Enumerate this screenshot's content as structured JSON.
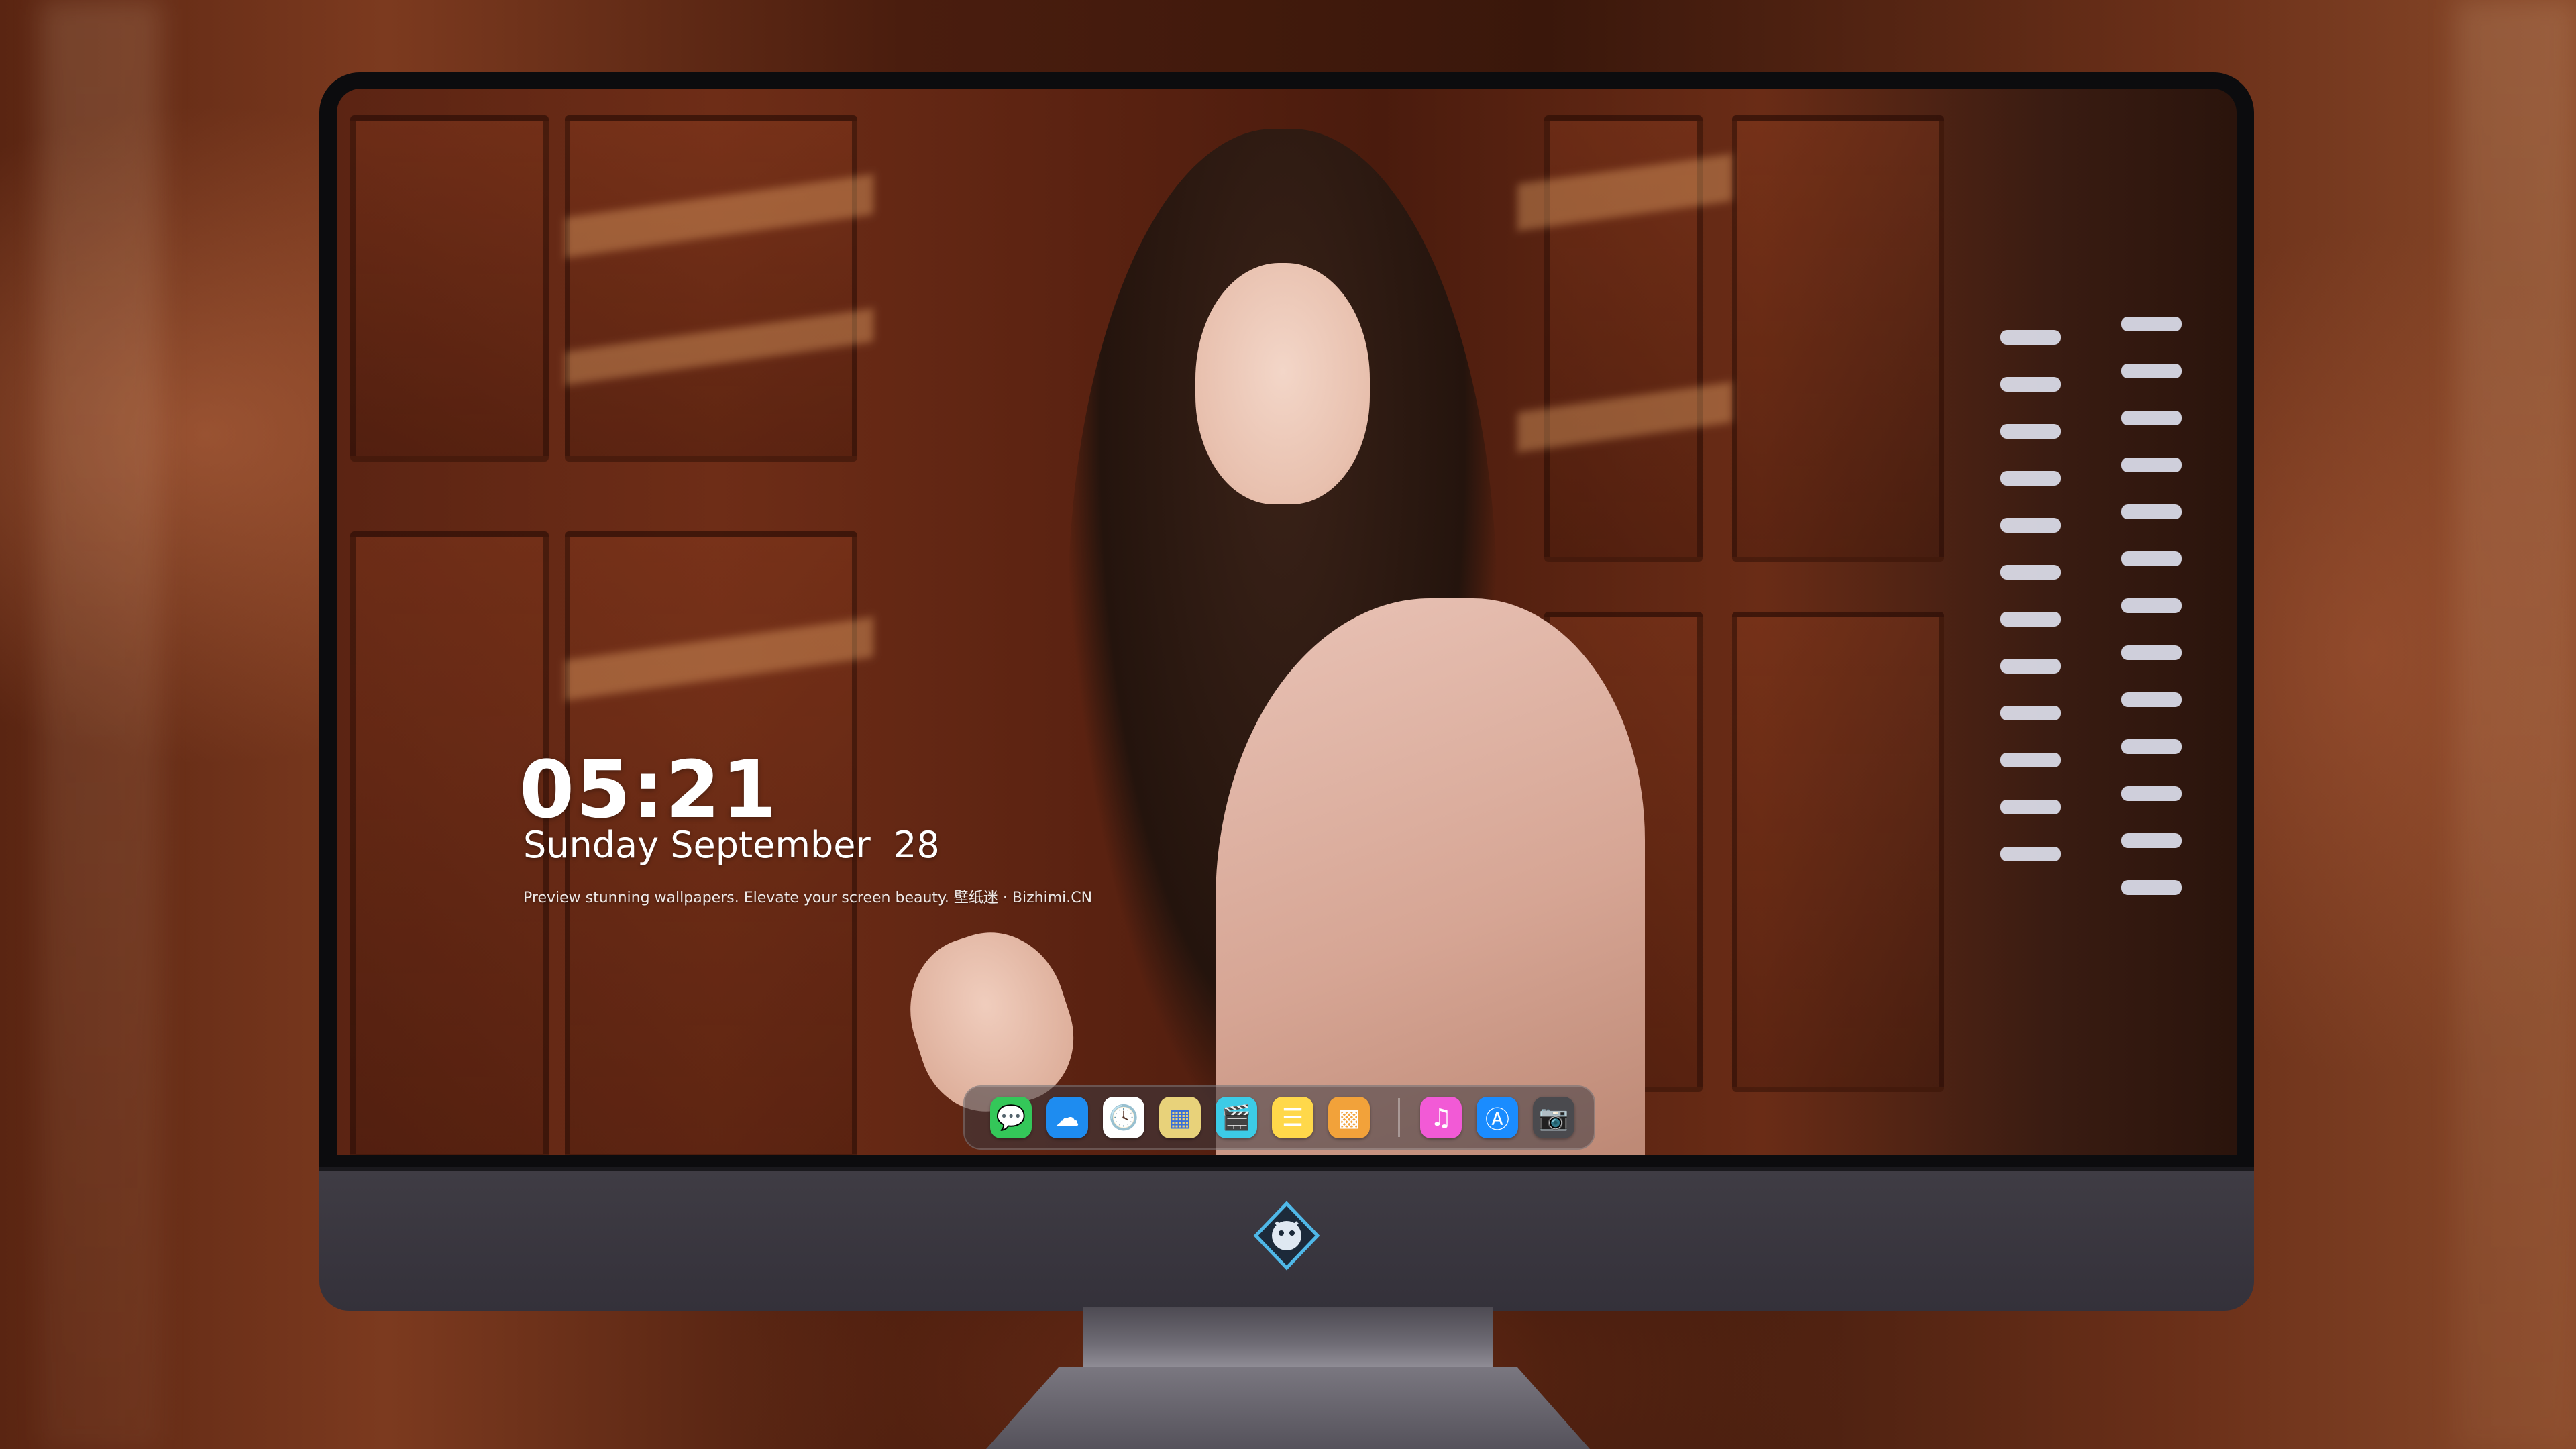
{
  "lock_screen": {
    "time": "05:21",
    "date": "Sunday September  28",
    "caption": "Preview stunning wallpapers. Elevate your screen beauty. 壁纸迷 · Bizhimi.CN"
  },
  "dock": {
    "apps": [
      {
        "name": "Messages",
        "icon": "messages-icon",
        "color": "#34c759",
        "glyph": "💬"
      },
      {
        "name": "Weather",
        "icon": "weather-icon",
        "color": "#1e8cf0",
        "glyph": "☁"
      },
      {
        "name": "Clock",
        "icon": "clock-icon",
        "color": "#ffffff",
        "glyph": "🕓"
      },
      {
        "name": "Preview",
        "icon": "preview-icon",
        "color": "#e8d27a",
        "glyph": "▦"
      },
      {
        "name": "Clips",
        "icon": "clips-icon",
        "color": "#3ccbe6",
        "glyph": "🎬"
      },
      {
        "name": "Notes",
        "icon": "notes-icon",
        "color": "#ffd84a",
        "glyph": "☰"
      },
      {
        "name": "Photo Booth",
        "icon": "photo-booth-icon",
        "color": "#f2a23a",
        "glyph": "▩"
      },
      {
        "name": "iTunes",
        "icon": "music-icon",
        "color": "#f25ad6",
        "glyph": "♫"
      },
      {
        "name": "App Store",
        "icon": "app-store-icon",
        "color": "#1a8cff",
        "glyph": "Ⓐ"
      },
      {
        "name": "Camera",
        "icon": "camera-icon",
        "color": "#4a4a4e",
        "glyph": "📷"
      }
    ]
  }
}
